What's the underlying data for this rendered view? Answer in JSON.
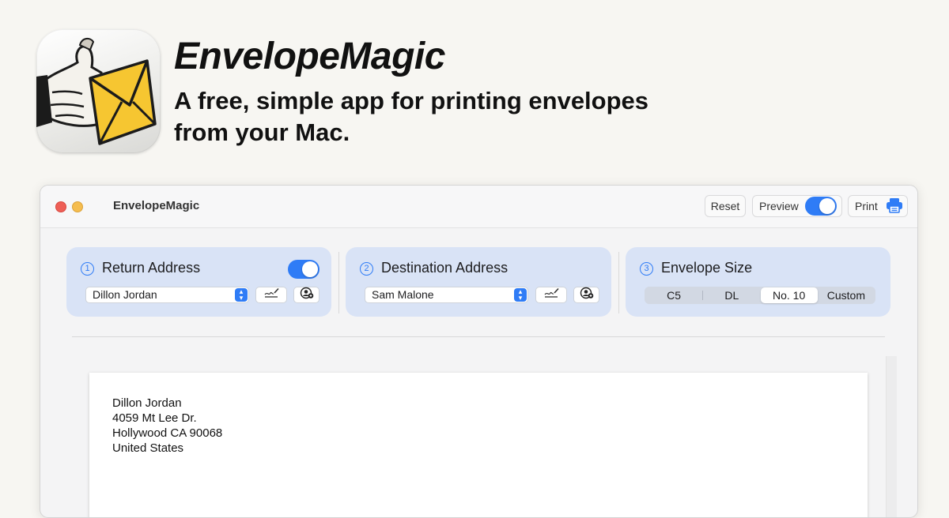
{
  "hero": {
    "title": "EnvelopeMagic",
    "tagline_line1": "A free, simple app for printing envelopes",
    "tagline_line2": "from your Mac."
  },
  "window": {
    "title": "EnvelopeMagic",
    "reset_label": "Reset",
    "preview_label": "Preview",
    "preview_enabled": true,
    "print_label": "Print"
  },
  "panels": {
    "return": {
      "step": "1",
      "title": "Return Address",
      "enabled": true,
      "selected_contact": "Dillon Jordan"
    },
    "destination": {
      "step": "2",
      "title": "Destination Address",
      "selected_contact": "Sam Malone"
    },
    "size": {
      "step": "3",
      "title": "Envelope Size",
      "options": [
        "C5",
        "DL",
        "No. 10",
        "Custom"
      ],
      "selected": "No. 10"
    }
  },
  "envelope": {
    "return_address": [
      "Dillon Jordan",
      "4059 Mt Lee Dr.",
      "Hollywood CA 90068",
      "United States"
    ]
  },
  "colors": {
    "accent": "#2f7cf6",
    "panel_bg": "#d9e3f6",
    "envelope_yellow": "#f6c631"
  },
  "icons": {
    "print": "printer-icon",
    "edit": "signature-edit-icon",
    "contacts": "contact-picker-icon"
  }
}
